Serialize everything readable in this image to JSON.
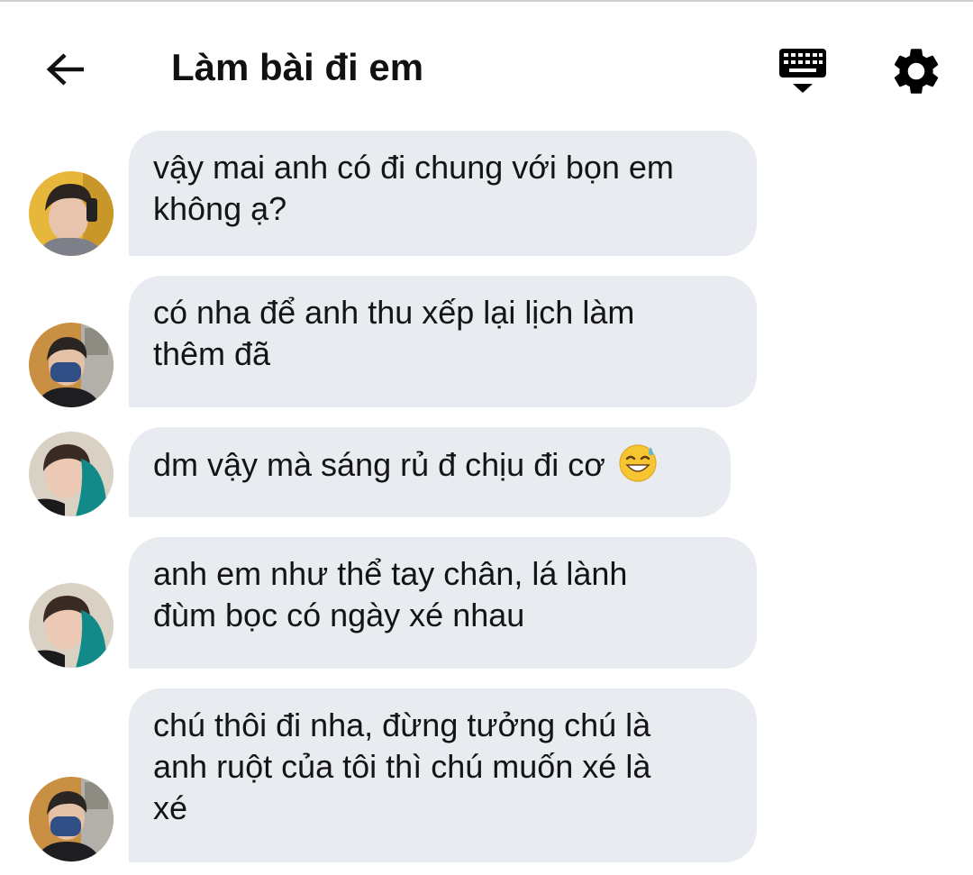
{
  "header": {
    "title": "Làm bài đi em",
    "back_icon": "arrow-left-icon",
    "keyboard_icon": "keyboard-hide-icon",
    "settings_icon": "gear-icon"
  },
  "messages": [
    {
      "avatar": "avatar-yellow-bg",
      "lines": [
        "vậy mai anh có đi chung với bọn em",
        "không ạ?"
      ]
    },
    {
      "avatar": "avatar-blue-mask",
      "lines": [
        "có nha để anh thu xếp lại lịch làm",
        "thêm đã"
      ]
    },
    {
      "avatar": "avatar-teal-hoodie",
      "lines": [
        "dm vậy mà sáng rủ đ chịu đi cơ"
      ],
      "emoji": "grinning-sweat-emoji"
    },
    {
      "avatar": "avatar-teal-hoodie",
      "lines": [
        "anh em như thể tay chân, lá lành",
        "đùm bọc có ngày xé nhau"
      ]
    },
    {
      "avatar": "avatar-blue-mask",
      "lines": [
        "chú thôi đi nha, đừng tưởng chú là",
        "anh ruột của tôi thì chú muốn xé là",
        "xé"
      ]
    }
  ],
  "colors": {
    "bubble": "#e8ebf0",
    "text": "#141414",
    "icon": "#000000"
  }
}
